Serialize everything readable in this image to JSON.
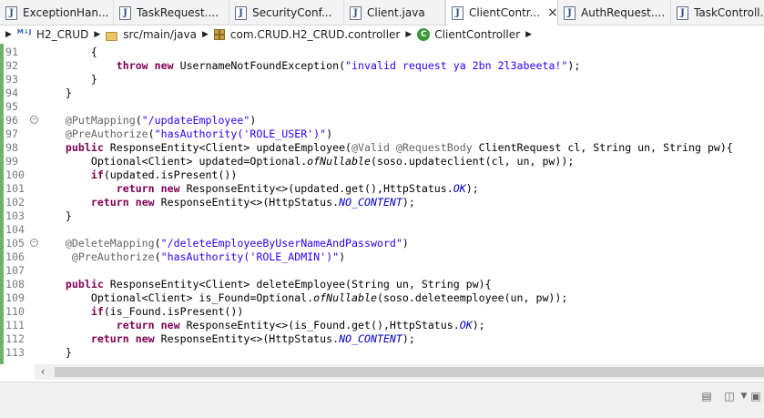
{
  "tabs": [
    {
      "label": "ExceptionHan...",
      "active": false
    },
    {
      "label": "TaskRequest....",
      "active": false
    },
    {
      "label": "SecurityConf...",
      "active": false
    },
    {
      "label": "Client.java",
      "active": false
    },
    {
      "label": "ClientContr...",
      "active": true
    },
    {
      "label": "AuthRequest....",
      "active": false
    },
    {
      "label": "TaskControll...",
      "active": false
    }
  ],
  "breadcrumb": {
    "project": "H2_CRUD",
    "source_folder": "src/main/java",
    "package": "com.CRUD.H2_CRUD.controller",
    "class": "ClientController"
  },
  "icons": {
    "java_file": "J",
    "close": "×",
    "project_badge": "M↓J",
    "class_badge": "C"
  },
  "code_lines": [
    {
      "n": "91",
      "text": "{"
    },
    {
      "n": "92",
      "text": "throw new UsernameNotFoundException(\"invalid request ya 2bn 2l3abeeta!\");"
    },
    {
      "n": "93",
      "text": "}"
    },
    {
      "n": "94",
      "text": "}"
    },
    {
      "n": "95",
      "text": ""
    },
    {
      "n": "96",
      "text": "@PutMapping(\"/updateEmployee\")"
    },
    {
      "n": "97",
      "text": "@PreAuthorize(\"hasAuthority('ROLE_USER')\")"
    },
    {
      "n": "98",
      "text": "public ResponseEntity<Client> updateEmployee(@Valid @RequestBody ClientRequest cl, String un, String pw){"
    },
    {
      "n": "99",
      "text": "Optional<Client> updated=Optional.ofNullable(soso.updateclient(cl, un, pw));"
    },
    {
      "n": "100",
      "text": "if(updated.isPresent())"
    },
    {
      "n": "101",
      "text": "return new ResponseEntity<>(updated.get(),HttpStatus.OK);"
    },
    {
      "n": "102",
      "text": "return new ResponseEntity<>(HttpStatus.NO_CONTENT);"
    },
    {
      "n": "103",
      "text": "}"
    },
    {
      "n": "104",
      "text": ""
    },
    {
      "n": "105",
      "text": "@DeleteMapping(\"/deleteEmployeeByUserNameAndPassword\")"
    },
    {
      "n": "106",
      "text": "@PreAuthorize(\"hasAuthority('ROLE_ADMIN')\")"
    },
    {
      "n": "107",
      "text": ""
    },
    {
      "n": "108",
      "text": "public ResponseEntity<Client> deleteEmployee(String un, String pw){"
    },
    {
      "n": "109",
      "text": "Optional<Client> is_Found=Optional.ofNullable(soso.deleteemployee(un, pw));"
    },
    {
      "n": "110",
      "text": "if(is_Found.isPresent())"
    },
    {
      "n": "111",
      "text": "return new ResponseEntity<>(is_Found.get(),HttpStatus.OK);"
    },
    {
      "n": "112",
      "text": "return new ResponseEntity<>(HttpStatus.NO_CONTENT);"
    },
    {
      "n": "113",
      "text": "}"
    }
  ],
  "colors": {
    "keyword": "#7f0055",
    "string": "#2a00ff",
    "annotation": "#646464",
    "static_field": "#0000c0",
    "ruler": "#6db36a"
  }
}
